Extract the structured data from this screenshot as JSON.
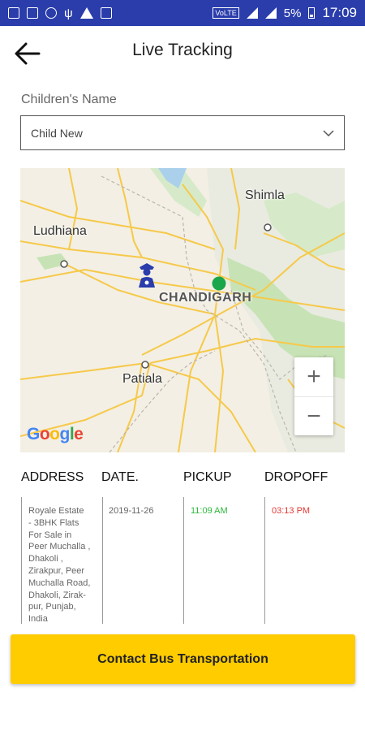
{
  "status_bar": {
    "network_label": "VoLTE",
    "battery_percent": "5%",
    "time": "17:09"
  },
  "header": {
    "title": "Live Tracking"
  },
  "children_field": {
    "label": "Children's Name",
    "selected": "Child New"
  },
  "map": {
    "labels": {
      "ludhiana": "Ludhiana",
      "shimla": "Shimla",
      "chandigarh": "CHANDIGARH",
      "patiala": "Patiala"
    },
    "zoom_in": "+",
    "zoom_out": "−",
    "attribution": "Google",
    "colors": {
      "road": "#f6c94a",
      "green_area": "#c7e3b5",
      "water": "#aad0ec",
      "bus_marker": "#2a3dab",
      "location_dot": "#1aa64a"
    }
  },
  "table": {
    "headers": [
      "ADDRESS",
      "DATE.",
      "PICKUP",
      "DROPOFF"
    ],
    "row": {
      "address_lines": [
        "Royale Estate",
        "- 3BHK Flats",
        "For Sale in",
        "Peer Muchalla ,",
        "Dhakoli ,",
        "Zirakpur, Peer",
        "Muchalla Road,",
        "Dhakoli, Zirak-",
        "pur, Punjab,",
        "India"
      ],
      "date": "2019-11-26",
      "pickup": "11:09 AM",
      "dropoff": "03:13 PM"
    }
  },
  "cta": {
    "label": "Contact Bus Transportation"
  }
}
